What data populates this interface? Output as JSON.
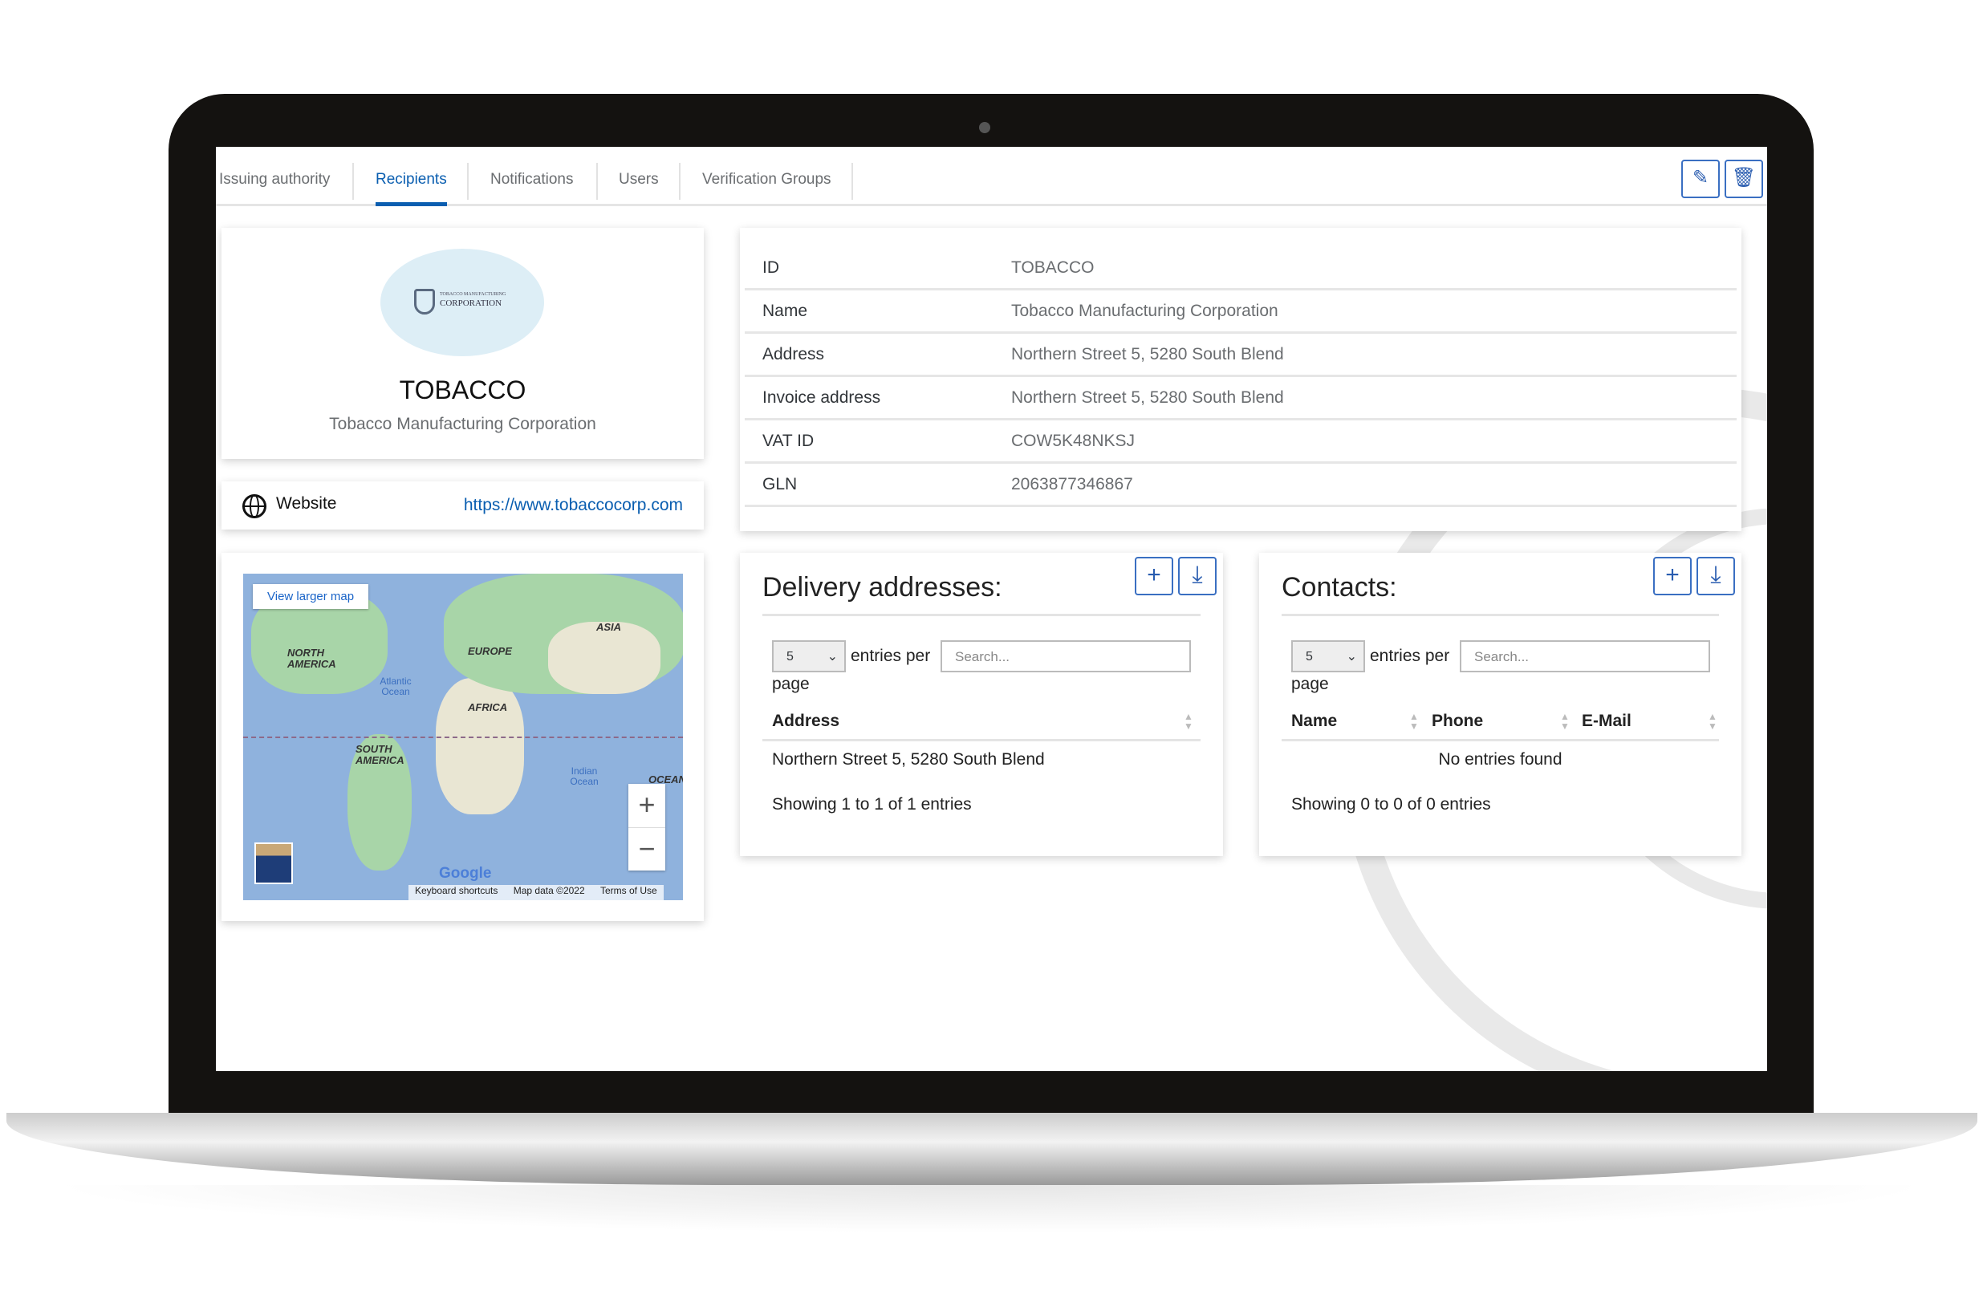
{
  "tabs": [
    {
      "label": "Issuing authority"
    },
    {
      "label": "Recipients",
      "active": true
    },
    {
      "label": "Notifications"
    },
    {
      "label": "Users"
    },
    {
      "label": "Verification Groups"
    }
  ],
  "toolbar": {
    "edit_icon": "pencil-icon",
    "delete_icon": "trash-icon"
  },
  "profile": {
    "logo_text_small": "TOBACCO MANUFACTURING",
    "logo_text": "CORPORATION",
    "id": "TOBACCO",
    "name": "Tobacco Manufacturing Corporation"
  },
  "website": {
    "label": "Website",
    "url": "https://www.tobaccocorp.com",
    "icon": "globe-icon"
  },
  "map": {
    "view_larger": "View larger map",
    "labels": {
      "na": "NORTH AMERICA",
      "europe": "EUROPE",
      "asia": "ASIA",
      "africa": "AFRICA",
      "sa": "SOUTH AMERICA",
      "atlantic": "Atlantic Ocean",
      "indian": "Indian Ocean",
      "oceania": "OCEAN"
    },
    "google": "Google",
    "footer": [
      "Keyboard shortcuts",
      "Map data ©2022",
      "Terms of Use"
    ],
    "zoom_in": "+",
    "zoom_out": "−"
  },
  "details": [
    {
      "key": "ID",
      "value": "TOBACCO"
    },
    {
      "key": "Name",
      "value": "Tobacco Manufacturing Corporation"
    },
    {
      "key": "Address",
      "value": "Northern Street 5, 5280 South Blend"
    },
    {
      "key": "Invoice address",
      "value": "Northern Street 5, 5280 South Blend"
    },
    {
      "key": "VAT ID",
      "value": "COW5K48NKSJ"
    },
    {
      "key": "GLN",
      "value": "2063877346867"
    }
  ],
  "delivery": {
    "title": "Delivery addresses:",
    "page_size": "5",
    "entries_per": "entries per",
    "page": "page",
    "search_placeholder": "Search...",
    "columns": [
      "Address"
    ],
    "rows": [
      [
        "Northern Street 5, 5280 South Blend"
      ]
    ],
    "footer": "Showing 1 to 1 of 1 entries"
  },
  "contacts": {
    "title": "Contacts:",
    "page_size": "5",
    "entries_per": "entries per",
    "page": "page",
    "search_placeholder": "Search...",
    "columns": [
      "Name",
      "Phone",
      "E-Mail"
    ],
    "empty": "No entries found",
    "footer": "Showing 0 to 0 of 0 entries"
  },
  "colors": {
    "accent": "#0a5eb0",
    "map_water": "#8fb2dd",
    "map_land": "#a8d5a8"
  }
}
